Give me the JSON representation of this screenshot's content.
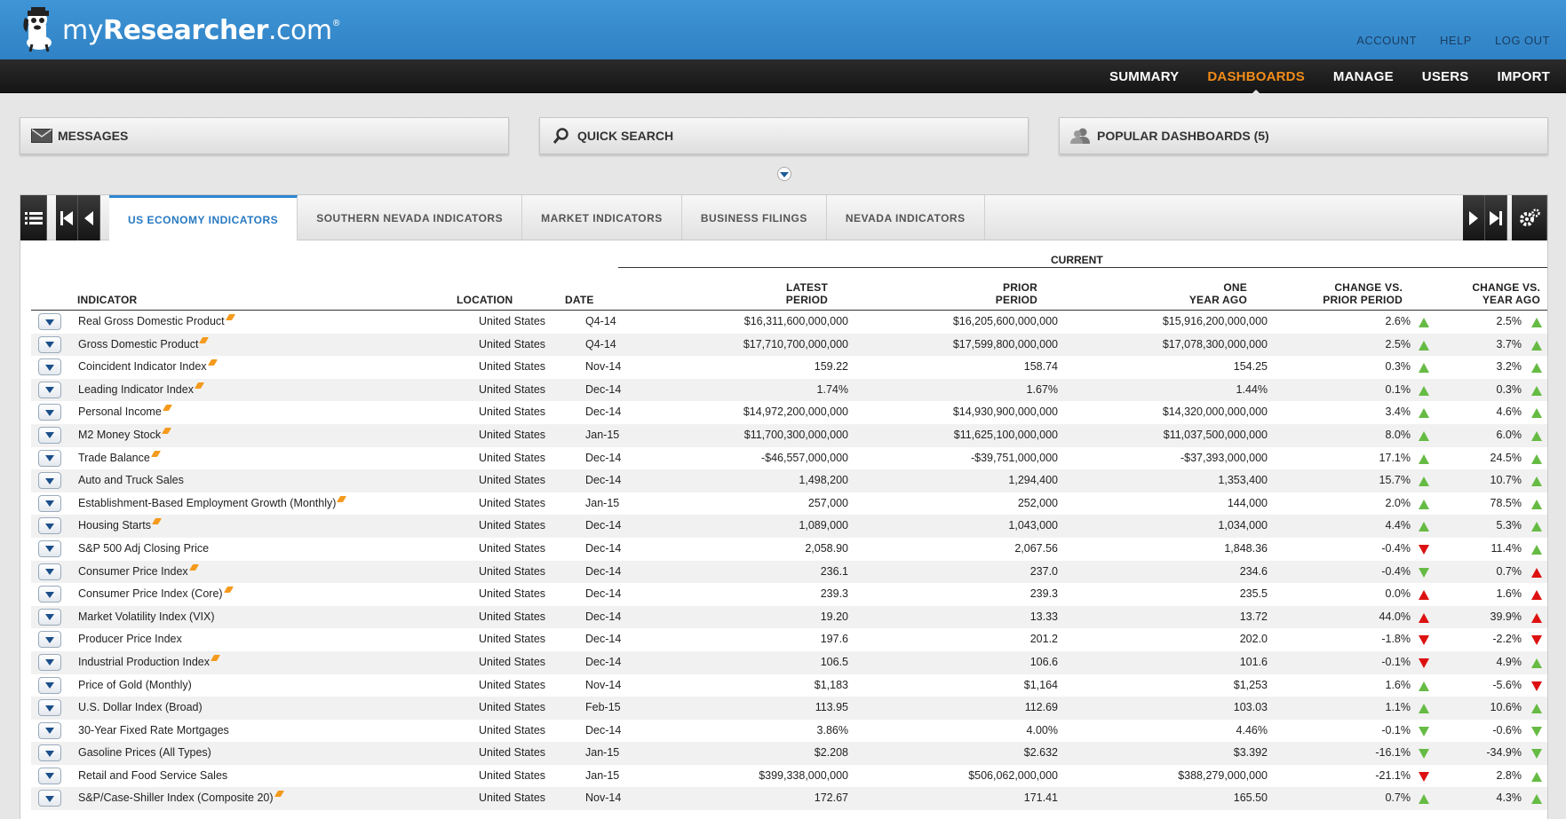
{
  "brand": {
    "name_prefix": "my",
    "name_main": "Researcher",
    "name_suffix": ".com",
    "registered": "®"
  },
  "top_links": [
    "ACCOUNT",
    "HELP",
    "LOG OUT"
  ],
  "nav": {
    "items": [
      "SUMMARY",
      "DASHBOARDS",
      "MANAGE",
      "USERS",
      "IMPORT"
    ],
    "active": "DASHBOARDS"
  },
  "widgets": {
    "messages": "MESSAGES",
    "quick_search": "QUICK SEARCH",
    "popular": "POPULAR DASHBOARDS (5)"
  },
  "tabs": {
    "items": [
      "US ECONOMY INDICATORS",
      "SOUTHERN NEVADA INDICATORS",
      "MARKET INDICATORS",
      "BUSINESS FILINGS",
      "NEVADA INDICATORS"
    ],
    "active": 0
  },
  "colors": {
    "accent": "#f28c18",
    "up_good": "#66bb44",
    "down_bad": "#dd1111",
    "up_bad": "#dd1111",
    "down_good": "#66bb44"
  },
  "table": {
    "group_label": "CURRENT",
    "headers": {
      "indicator": "INDICATOR",
      "location": "LOCATION",
      "date": "DATE",
      "latest_1": "LATEST",
      "latest_2": "PERIOD",
      "prior_1": "PRIOR",
      "prior_2": "PERIOD",
      "year_1": "ONE",
      "year_2": "YEAR AGO",
      "chg_prior_1": "CHANGE VS.",
      "chg_prior_2": "PRIOR PERIOD",
      "chg_year_1": "CHANGE VS.",
      "chg_year_2": "YEAR AGO"
    },
    "rows": [
      {
        "indicator": "Real Gross Domestic Product",
        "flag": true,
        "location": "United States",
        "date": "Q4-14",
        "latest": "$16,311,600,000,000",
        "prior": "$16,205,600,000,000",
        "year_ago": "$15,916,200,000,000",
        "chg_prior": "2.6%",
        "chg_prior_dir": "up",
        "chg_prior_color": "green",
        "chg_year": "2.5%",
        "chg_year_dir": "up",
        "chg_year_color": "green"
      },
      {
        "indicator": "Gross Domestic Product",
        "flag": true,
        "location": "United States",
        "date": "Q4-14",
        "latest": "$17,710,700,000,000",
        "prior": "$17,599,800,000,000",
        "year_ago": "$17,078,300,000,000",
        "chg_prior": "2.5%",
        "chg_prior_dir": "up",
        "chg_prior_color": "green",
        "chg_year": "3.7%",
        "chg_year_dir": "up",
        "chg_year_color": "green"
      },
      {
        "indicator": "Coincident Indicator Index",
        "flag": true,
        "location": "United States",
        "date": "Nov-14",
        "latest": "159.22",
        "prior": "158.74",
        "year_ago": "154.25",
        "chg_prior": "0.3%",
        "chg_prior_dir": "up",
        "chg_prior_color": "green",
        "chg_year": "3.2%",
        "chg_year_dir": "up",
        "chg_year_color": "green"
      },
      {
        "indicator": "Leading Indicator Index",
        "flag": true,
        "location": "United States",
        "date": "Dec-14",
        "latest": "1.74%",
        "prior": "1.67%",
        "year_ago": "1.44%",
        "chg_prior": "0.1%",
        "chg_prior_dir": "up",
        "chg_prior_color": "green",
        "chg_year": "0.3%",
        "chg_year_dir": "up",
        "chg_year_color": "green"
      },
      {
        "indicator": "Personal Income",
        "flag": true,
        "location": "United States",
        "date": "Dec-14",
        "latest": "$14,972,200,000,000",
        "prior": "$14,930,900,000,000",
        "year_ago": "$14,320,000,000,000",
        "chg_prior": "3.4%",
        "chg_prior_dir": "up",
        "chg_prior_color": "green",
        "chg_year": "4.6%",
        "chg_year_dir": "up",
        "chg_year_color": "green"
      },
      {
        "indicator": "M2 Money Stock",
        "flag": true,
        "location": "United States",
        "date": "Jan-15",
        "latest": "$11,700,300,000,000",
        "prior": "$11,625,100,000,000",
        "year_ago": "$11,037,500,000,000",
        "chg_prior": "8.0%",
        "chg_prior_dir": "up",
        "chg_prior_color": "green",
        "chg_year": "6.0%",
        "chg_year_dir": "up",
        "chg_year_color": "green"
      },
      {
        "indicator": "Trade Balance",
        "flag": true,
        "location": "United States",
        "date": "Dec-14",
        "latest": "-$46,557,000,000",
        "prior": "-$39,751,000,000",
        "year_ago": "-$37,393,000,000",
        "chg_prior": "17.1%",
        "chg_prior_dir": "up",
        "chg_prior_color": "green",
        "chg_year": "24.5%",
        "chg_year_dir": "up",
        "chg_year_color": "green"
      },
      {
        "indicator": "Auto and Truck Sales",
        "flag": false,
        "location": "United States",
        "date": "Dec-14",
        "latest": "1,498,200",
        "prior": "1,294,400",
        "year_ago": "1,353,400",
        "chg_prior": "15.7%",
        "chg_prior_dir": "up",
        "chg_prior_color": "green",
        "chg_year": "10.7%",
        "chg_year_dir": "up",
        "chg_year_color": "green"
      },
      {
        "indicator": "Establishment-Based Employment Growth (Monthly)",
        "flag": true,
        "location": "United States",
        "date": "Jan-15",
        "latest": "257,000",
        "prior": "252,000",
        "year_ago": "144,000",
        "chg_prior": "2.0%",
        "chg_prior_dir": "up",
        "chg_prior_color": "green",
        "chg_year": "78.5%",
        "chg_year_dir": "up",
        "chg_year_color": "green"
      },
      {
        "indicator": "Housing Starts",
        "flag": true,
        "location": "United States",
        "date": "Dec-14",
        "latest": "1,089,000",
        "prior": "1,043,000",
        "year_ago": "1,034,000",
        "chg_prior": "4.4%",
        "chg_prior_dir": "up",
        "chg_prior_color": "green",
        "chg_year": "5.3%",
        "chg_year_dir": "up",
        "chg_year_color": "green"
      },
      {
        "indicator": "S&P 500 Adj Closing Price",
        "flag": false,
        "location": "United States",
        "date": "Dec-14",
        "latest": "2,058.90",
        "prior": "2,067.56",
        "year_ago": "1,848.36",
        "chg_prior": "-0.4%",
        "chg_prior_dir": "down",
        "chg_prior_color": "red",
        "chg_year": "11.4%",
        "chg_year_dir": "up",
        "chg_year_color": "green"
      },
      {
        "indicator": "Consumer Price Index",
        "flag": true,
        "location": "United States",
        "date": "Dec-14",
        "latest": "236.1",
        "prior": "237.0",
        "year_ago": "234.6",
        "chg_prior": "-0.4%",
        "chg_prior_dir": "down",
        "chg_prior_color": "green",
        "chg_year": "0.7%",
        "chg_year_dir": "up",
        "chg_year_color": "red"
      },
      {
        "indicator": "Consumer Price Index (Core)",
        "flag": true,
        "location": "United States",
        "date": "Dec-14",
        "latest": "239.3",
        "prior": "239.3",
        "year_ago": "235.5",
        "chg_prior": "0.0%",
        "chg_prior_dir": "up",
        "chg_prior_color": "red",
        "chg_year": "1.6%",
        "chg_year_dir": "up",
        "chg_year_color": "red"
      },
      {
        "indicator": "Market Volatility Index (VIX)",
        "flag": false,
        "location": "United States",
        "date": "Dec-14",
        "latest": "19.20",
        "prior": "13.33",
        "year_ago": "13.72",
        "chg_prior": "44.0%",
        "chg_prior_dir": "up",
        "chg_prior_color": "red",
        "chg_year": "39.9%",
        "chg_year_dir": "up",
        "chg_year_color": "red"
      },
      {
        "indicator": "Producer Price Index",
        "flag": false,
        "location": "United States",
        "date": "Dec-14",
        "latest": "197.6",
        "prior": "201.2",
        "year_ago": "202.0",
        "chg_prior": "-1.8%",
        "chg_prior_dir": "down",
        "chg_prior_color": "red",
        "chg_year": "-2.2%",
        "chg_year_dir": "down",
        "chg_year_color": "red"
      },
      {
        "indicator": "Industrial Production Index",
        "flag": true,
        "location": "United States",
        "date": "Dec-14",
        "latest": "106.5",
        "prior": "106.6",
        "year_ago": "101.6",
        "chg_prior": "-0.1%",
        "chg_prior_dir": "down",
        "chg_prior_color": "red",
        "chg_year": "4.9%",
        "chg_year_dir": "up",
        "chg_year_color": "green"
      },
      {
        "indicator": "Price of Gold (Monthly)",
        "flag": false,
        "location": "United States",
        "date": "Nov-14",
        "latest": "$1,183",
        "prior": "$1,164",
        "year_ago": "$1,253",
        "chg_prior": "1.6%",
        "chg_prior_dir": "up",
        "chg_prior_color": "green",
        "chg_year": "-5.6%",
        "chg_year_dir": "down",
        "chg_year_color": "red"
      },
      {
        "indicator": "U.S. Dollar Index (Broad)",
        "flag": false,
        "location": "United States",
        "date": "Feb-15",
        "latest": "113.95",
        "prior": "112.69",
        "year_ago": "103.03",
        "chg_prior": "1.1%",
        "chg_prior_dir": "up",
        "chg_prior_color": "green",
        "chg_year": "10.6%",
        "chg_year_dir": "up",
        "chg_year_color": "green"
      },
      {
        "indicator": "30-Year Fixed Rate Mortgages",
        "flag": false,
        "location": "United States",
        "date": "Dec-14",
        "latest": "3.86%",
        "prior": "4.00%",
        "year_ago": "4.46%",
        "chg_prior": "-0.1%",
        "chg_prior_dir": "down",
        "chg_prior_color": "green",
        "chg_year": "-0.6%",
        "chg_year_dir": "down",
        "chg_year_color": "green"
      },
      {
        "indicator": "Gasoline Prices (All Types)",
        "flag": false,
        "location": "United States",
        "date": "Jan-15",
        "latest": "$2.208",
        "prior": "$2.632",
        "year_ago": "$3.392",
        "chg_prior": "-16.1%",
        "chg_prior_dir": "down",
        "chg_prior_color": "green",
        "chg_year": "-34.9%",
        "chg_year_dir": "down",
        "chg_year_color": "green"
      },
      {
        "indicator": "Retail and Food Service Sales",
        "flag": false,
        "location": "United States",
        "date": "Jan-15",
        "latest": "$399,338,000,000",
        "prior": "$506,062,000,000",
        "year_ago": "$388,279,000,000",
        "chg_prior": "-21.1%",
        "chg_prior_dir": "down",
        "chg_prior_color": "red",
        "chg_year": "2.8%",
        "chg_year_dir": "up",
        "chg_year_color": "green"
      },
      {
        "indicator": "S&P/Case-Shiller Index (Composite 20)",
        "flag": true,
        "location": "United States",
        "date": "Nov-14",
        "latest": "172.67",
        "prior": "171.41",
        "year_ago": "165.50",
        "chg_prior": "0.7%",
        "chg_prior_dir": "up",
        "chg_prior_color": "green",
        "chg_year": "4.3%",
        "chg_year_dir": "up",
        "chg_year_color": "green"
      }
    ]
  }
}
